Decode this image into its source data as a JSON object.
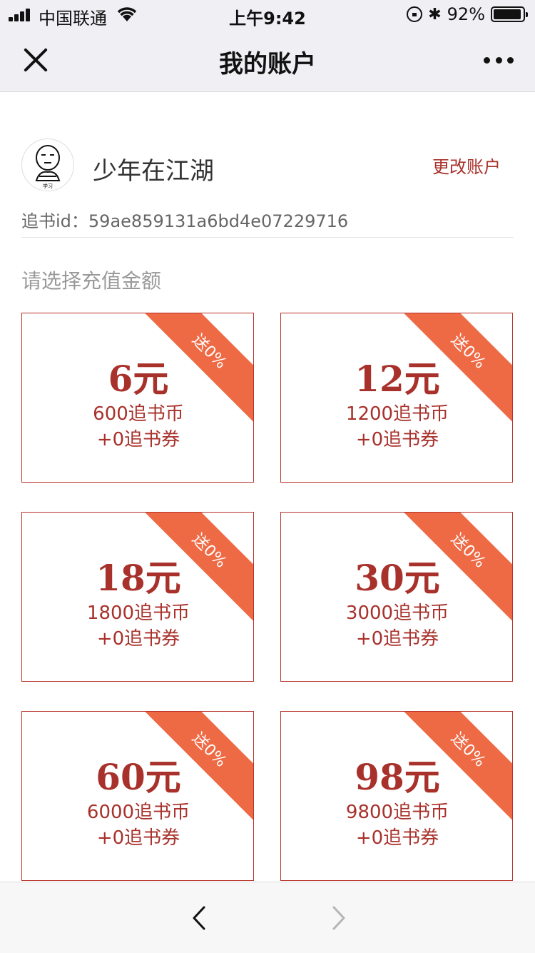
{
  "status_bar": {
    "carrier": "中国联通",
    "time": "上午9:42",
    "battery": "92%",
    "icons": [
      "signal-icon",
      "wifi-icon",
      "orientation-lock-icon",
      "bluetooth-icon",
      "battery-icon"
    ]
  },
  "nav": {
    "title": "我的账户",
    "icons": [
      "close-icon",
      "more-icon"
    ]
  },
  "account": {
    "username": "少年在江湖",
    "change_label": "更改账户",
    "id_label": "追书id：",
    "id_value": "59ae859131a6bd4e07229716",
    "avatar_text": "学习"
  },
  "recharge": {
    "prompt": "请选择充值金额",
    "options": [
      {
        "price": "6元",
        "coins": "600追书币",
        "vouchers": "+0追书券",
        "bonus": "送0%"
      },
      {
        "price": "12元",
        "coins": "1200追书币",
        "vouchers": "+0追书券",
        "bonus": "送0%"
      },
      {
        "price": "18元",
        "coins": "1800追书币",
        "vouchers": "+0追书券",
        "bonus": "送0%"
      },
      {
        "price": "30元",
        "coins": "3000追书币",
        "vouchers": "+0追书券",
        "bonus": "送0%"
      },
      {
        "price": "60元",
        "coins": "6000追书币",
        "vouchers": "+0追书券",
        "bonus": "送0%"
      },
      {
        "price": "98元",
        "coins": "9800追书币",
        "vouchers": "+0追书券",
        "bonus": "送0%"
      }
    ]
  },
  "toolbar": {
    "icons": [
      "back-arrow-icon",
      "forward-arrow-icon"
    ]
  },
  "colors": {
    "accent": "#a8312b",
    "ribbon": "#ee6a45",
    "bar_bg": "#efeff4"
  }
}
